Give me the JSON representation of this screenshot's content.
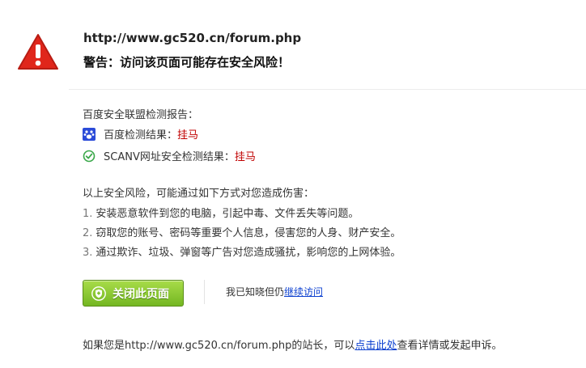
{
  "header": {
    "url": "http://www.gc520.cn/forum.php",
    "warning": "警告：访问该页面可能存在安全风险！",
    "icon": "warning-triangle-icon",
    "accent": "#e0261b"
  },
  "report": {
    "title": "百度安全联盟检测报告：",
    "items": [
      {
        "icon": "baidu-paw-icon",
        "label": "百度检测结果：",
        "result": "挂马"
      },
      {
        "icon": "check-circle-icon",
        "label": "SCANV网址安全检测结果：",
        "result": "挂马"
      }
    ],
    "result_color": "#c00000"
  },
  "risks": {
    "title": "以上安全风险，可能通过如下方式对您造成伤害：",
    "items": [
      {
        "num": "1.",
        "text": "安装恶意软件到您的电脑，引起中毒、文件丢失等问题。"
      },
      {
        "num": "2.",
        "text": "窃取您的账号、密码等重要个人信息，侵害您的人身、财产安全。"
      },
      {
        "num": "3.",
        "text": "通过欺诈、垃圾、弹窗等广告对您造成骚扰，影响您的上网体验。"
      }
    ]
  },
  "actions": {
    "close_label": "关闭此页面",
    "close_icon": "shield-icon",
    "continue_prefix": "我已知晓但仍",
    "continue_link": "继续访问",
    "button_color": "#7dbf28"
  },
  "owner": {
    "prefix": "如果您是http://www.gc520.cn/forum.php的站长，可以",
    "link": "点击此处",
    "suffix": "查看详情或发起申诉。"
  }
}
